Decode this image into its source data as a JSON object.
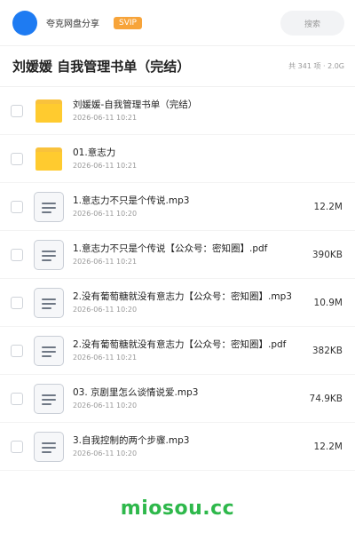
{
  "header": {
    "share_label": "夸克网盘分享",
    "badge": "SVIP",
    "search_label": "搜索"
  },
  "folder": {
    "title": "刘媛媛 自我管理书单（完结）",
    "meta": "共 341 项 · 2.0G"
  },
  "files": [
    {
      "name": "刘媛媛-自我管理书单（完结）",
      "date": "2026-06-11 10:21",
      "size": "",
      "icon": "folder-icon"
    },
    {
      "name": "01.意志力",
      "date": "2026-06-11 10:21",
      "size": "",
      "icon": "folder-icon"
    },
    {
      "name": "1.意志力不只是个传说.mp3",
      "date": "2026-06-11 10:20",
      "size": "12.2M",
      "icon": "document-icon"
    },
    {
      "name": "1.意志力不只是个传说【公众号：密知圈】.pdf",
      "date": "2026-06-11 10:21",
      "size": "390KB",
      "icon": "document-icon"
    },
    {
      "name": "2.没有葡萄糖就没有意志力【公众号：密知圈】.mp3",
      "date": "2026-06-11 10:20",
      "size": "10.9M",
      "icon": "document-icon"
    },
    {
      "name": "2.没有葡萄糖就没有意志力【公众号：密知圈】.pdf",
      "date": "2026-06-11 10:21",
      "size": "382KB",
      "icon": "document-icon"
    },
    {
      "name": "03. 京剧里怎么谈情说爱.mp3",
      "date": "2026-06-11 10:20",
      "size": "74.9KB",
      "icon": "document-icon"
    },
    {
      "name": "3.自我控制的两个步骤.mp3",
      "date": "2026-06-11 10:20",
      "size": "12.2M",
      "icon": "document-icon"
    }
  ],
  "watermark": "miosou.cc",
  "colors": {
    "brand": "#1e7bf2",
    "svip": "#f7a43a",
    "folder": "#ffcb2f",
    "watermark": "#2eb84b"
  }
}
